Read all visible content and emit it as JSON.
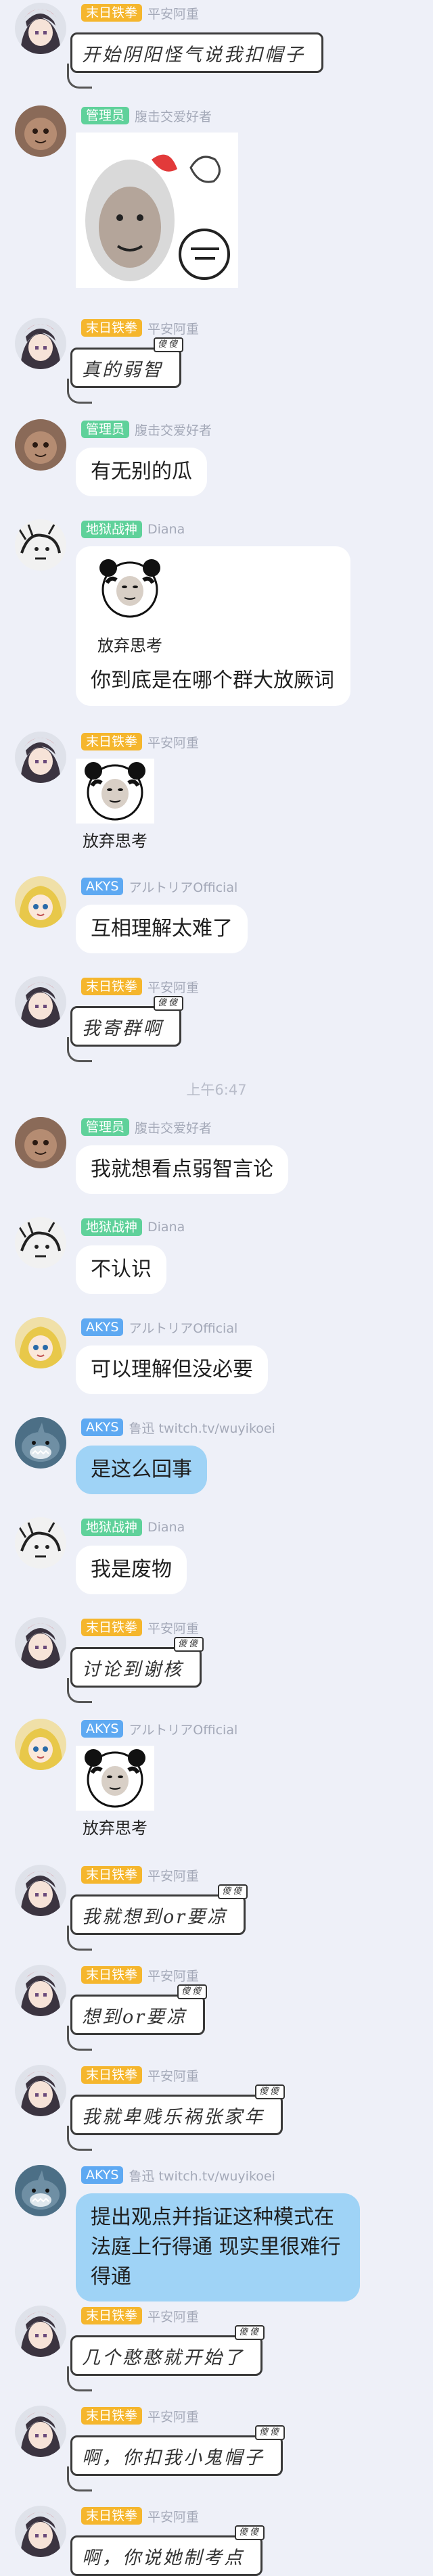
{
  "colors": {
    "badge_orange": "#f5b62d",
    "badge_green": "#5fd19a",
    "badge_blue": "#5ea9f2",
    "badge_akys": "#5ea9f2",
    "bubble_blue": "#9fd3f6"
  },
  "messages": [
    {
      "badge": "末日铁拳",
      "name": "平安阿重",
      "text": "开始阴阳怪气说我扣帽子"
    },
    {
      "badge": "管理员",
      "name": "腹击交爱好者",
      "sticker": "meme"
    },
    {
      "badge": "末日铁拳",
      "name": "平安阿重",
      "text": "真的弱智",
      "tag": "傻傻"
    },
    {
      "badge": "管理员",
      "name": "腹击交爱好者",
      "text": "有无别的瓜"
    },
    {
      "badge": "地狱战神",
      "name": "Diana",
      "caption": "放弃思考",
      "text": "你到底是在哪个群大放厥词"
    },
    {
      "badge": "末日铁拳",
      "name": "平安阿重",
      "caption": "放弃思考"
    },
    {
      "badge": "AKYS",
      "name": "アルトリアOfficial",
      "text": "互相理解太难了"
    },
    {
      "badge": "末日铁拳",
      "name": "平安阿重",
      "text": "我寄群啊",
      "tag": "傻傻"
    },
    {
      "timestamp": "上午6:47"
    },
    {
      "badge": "管理员",
      "name": "腹击交爱好者",
      "text": "我就想看点弱智言论"
    },
    {
      "badge": "地狱战神",
      "name": "Diana",
      "text": "不认识"
    },
    {
      "badge": "AKYS",
      "name": "アルトリアOfficial",
      "text": "可以理解但没必要"
    },
    {
      "badge": "AKYS",
      "name": "鲁迅 twitch.tv/wuyikoei",
      "text": "是这么回事"
    },
    {
      "badge": "地狱战神",
      "name": "Diana",
      "text": "我是废物"
    },
    {
      "badge": "末日铁拳",
      "name": "平安阿重",
      "text": "讨论到谢核",
      "tag": "傻傻"
    },
    {
      "badge": "AKYS",
      "name": "アルトリアOfficial",
      "caption": "放弃思考"
    },
    {
      "badge": "末日铁拳",
      "name": "平安阿重",
      "text": "我就想到or要凉",
      "tag": "傻傻"
    },
    {
      "badge": "末日铁拳",
      "name": "平安阿重",
      "text": "想到or要凉",
      "tag": "傻傻"
    },
    {
      "badge": "末日铁拳",
      "name": "平安阿重",
      "text": "我就卑贱乐祸张家年",
      "tag": "傻傻"
    },
    {
      "badge": "AKYS",
      "name": "鲁迅 twitch.tv/wuyikoei",
      "text": "提出观点并指证这种模式在法庭上行得通 现实里很难行得通"
    },
    {
      "badge": "末日铁拳",
      "name": "平安阿重",
      "text": "几个憨憨就开始了",
      "tag": "傻傻"
    },
    {
      "badge": "末日铁拳",
      "name": "平安阿重",
      "text": "啊，你扣我小鬼帽子",
      "tag": "傻傻"
    },
    {
      "badge": "末日铁拳",
      "name": "平安阿重",
      "text": "啊，你说她制考点",
      "tag": "傻傻"
    }
  ]
}
